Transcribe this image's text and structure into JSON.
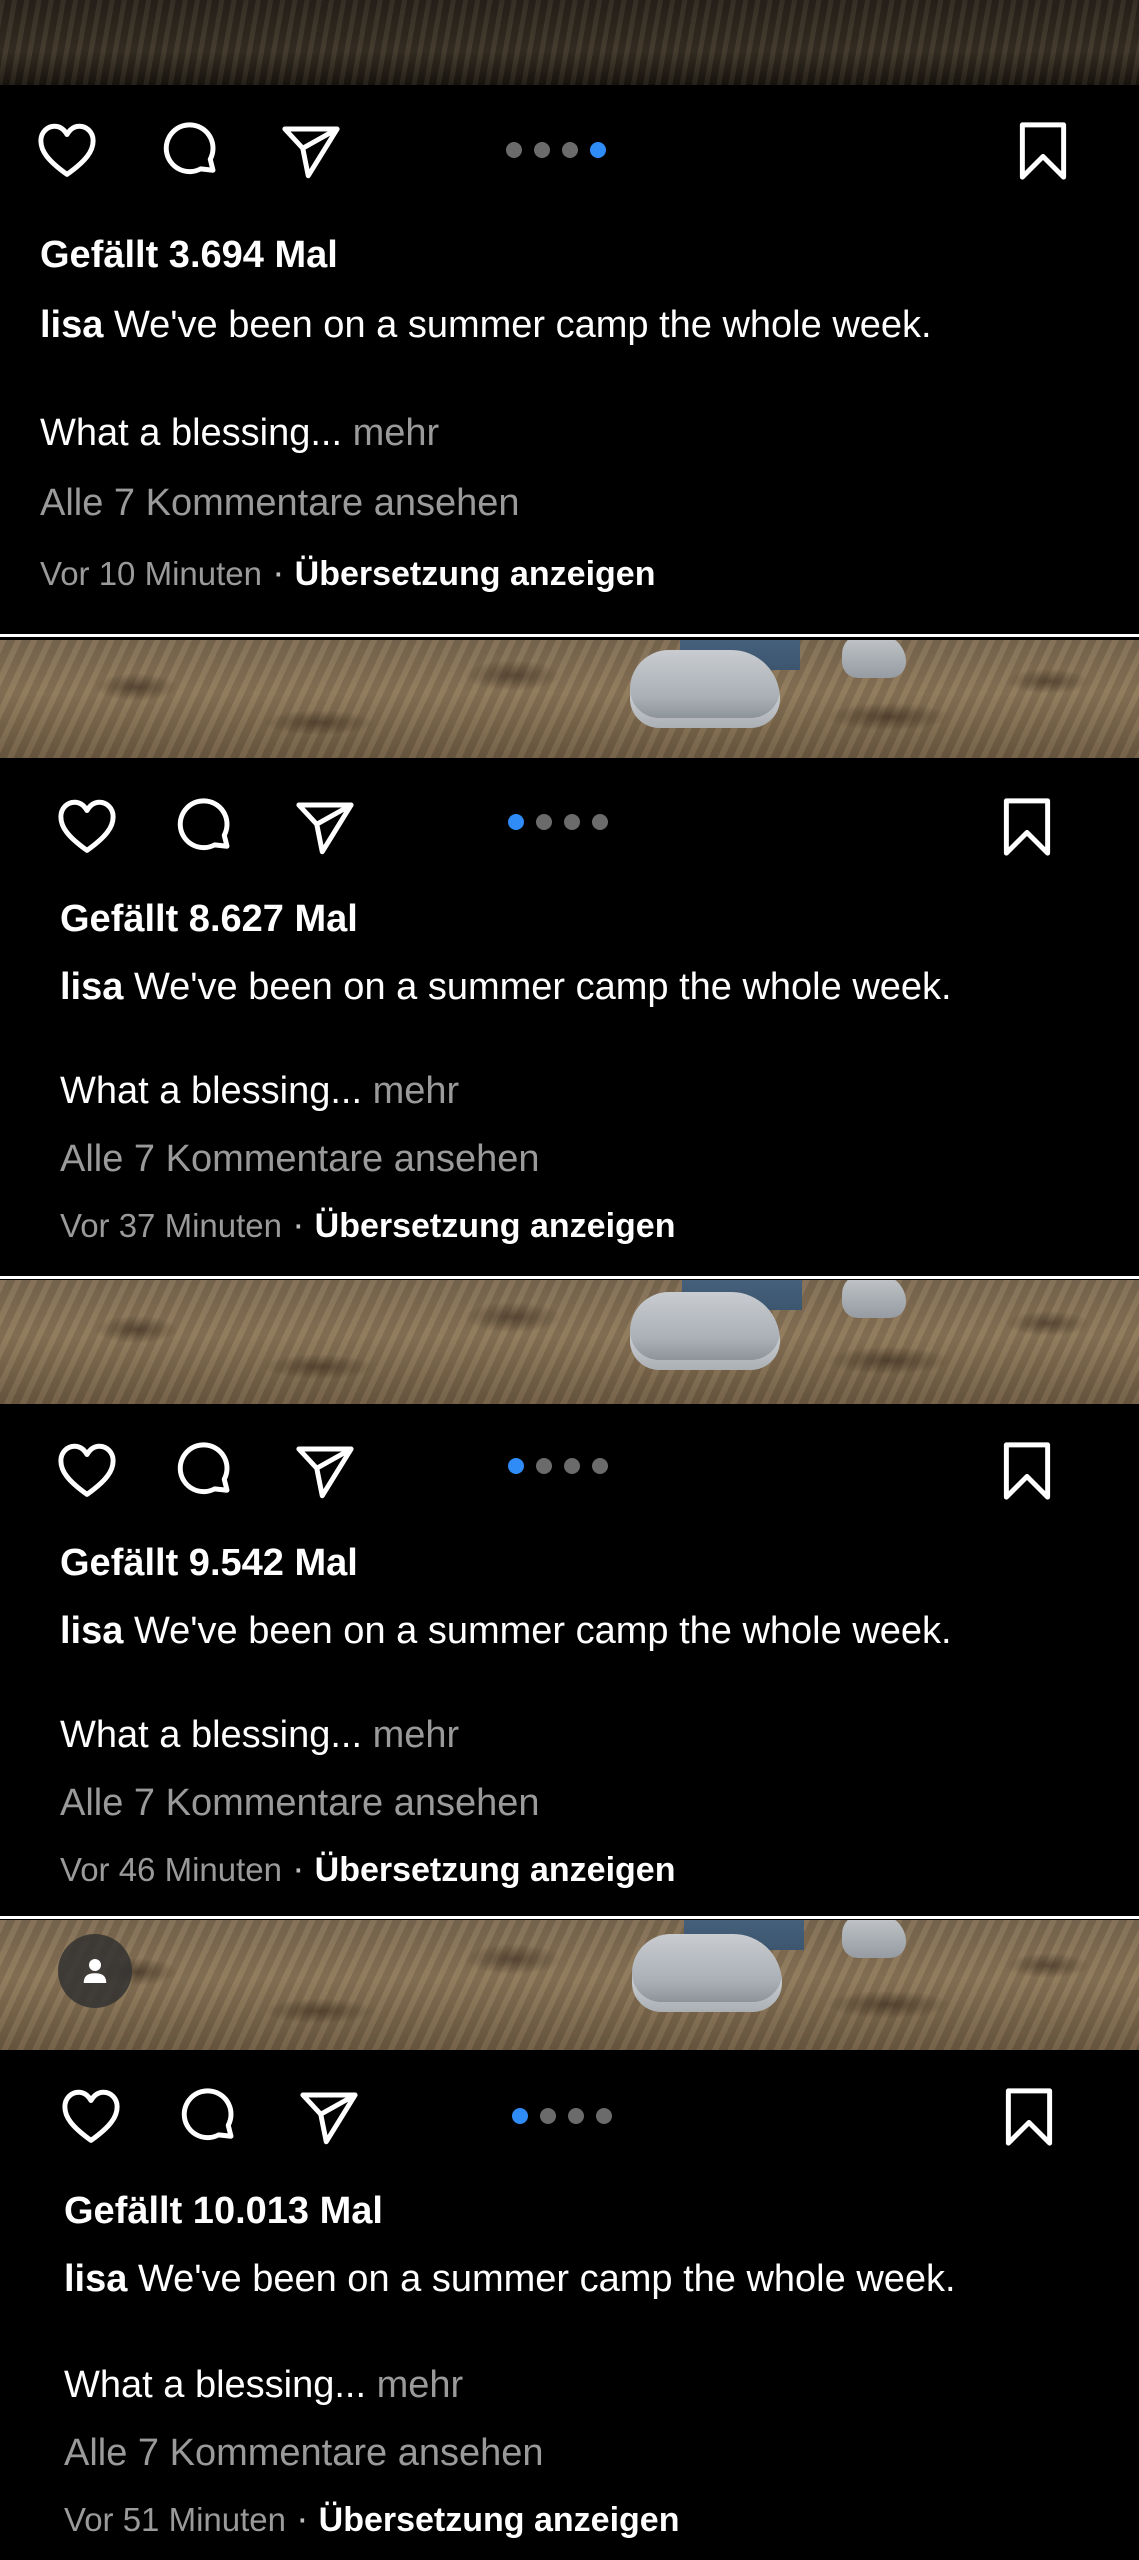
{
  "posts": [
    {
      "likes": "Gefällt 3.694 Mal",
      "username": "lisa",
      "caption": "We've been on a summer camp the whole week.",
      "caption_more": "What a blessing...",
      "more_label": "mehr",
      "comments_link": "Alle 7 Kommentare ansehen",
      "time": "Vor 10 Minuten",
      "separator": "·",
      "translate": "Übersetzung anzeigen",
      "active_slide": 4,
      "slide_count": 4
    },
    {
      "likes": "Gefällt 8.627 Mal",
      "username": "lisa",
      "caption": "We've been on a summer camp the whole week.",
      "caption_more": "What a blessing...",
      "more_label": "mehr",
      "comments_link": "Alle 7 Kommentare ansehen",
      "time": "Vor 37 Minuten",
      "separator": "·",
      "translate": "Übersetzung anzeigen",
      "active_slide": 1,
      "slide_count": 4
    },
    {
      "likes": "Gefällt 9.542 Mal",
      "username": "lisa",
      "caption": "We've been on a summer camp the whole week.",
      "caption_more": "What a blessing...",
      "more_label": "mehr",
      "comments_link": "Alle 7 Kommentare ansehen",
      "time": "Vor 46 Minuten",
      "separator": "·",
      "translate": "Übersetzung anzeigen",
      "active_slide": 1,
      "slide_count": 4
    },
    {
      "likes": "Gefällt 10.013 Mal",
      "username": "lisa",
      "caption": "We've been on a summer camp the whole week.",
      "caption_more": "What a blessing...",
      "more_label": "mehr",
      "comments_link": "Alle 7 Kommentare ansehen",
      "time": "Vor 51 Minuten",
      "separator": "·",
      "translate": "Übersetzung anzeigen",
      "active_slide": 1,
      "slide_count": 4
    }
  ],
  "icons": {
    "like": "heart-icon",
    "comment": "comment-icon",
    "share": "paper-plane-icon",
    "save": "bookmark-icon",
    "tagged_user": "person-icon"
  },
  "colors": {
    "background": "#000000",
    "text": "#ffffff",
    "muted": "#9a9a9a",
    "active_dot": "#2f8cf7",
    "inactive_dot": "#6b6b6b"
  }
}
